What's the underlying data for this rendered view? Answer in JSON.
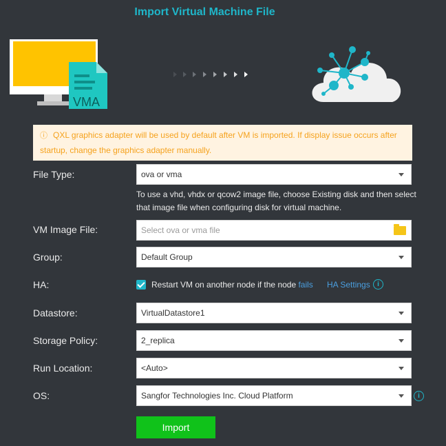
{
  "title": "Import Virtual Machine File",
  "hero": {
    "file_badge": "VMA"
  },
  "notice": {
    "icon": "warning-circle-icon",
    "text": "QXL graphics adapter will be used by default after VM is imported. If display issue occurs after startup, change the graphics adapter manually."
  },
  "form": {
    "file_type": {
      "label": "File Type:",
      "value": "ova or vma"
    },
    "hint": "To use a vhd, vhdx or qcow2 image file, choose Existing disk and then select that image file when configuring disk for virtual machine.",
    "vm_image_file": {
      "label": "VM Image File:",
      "placeholder": "Select ova or vma file"
    },
    "group": {
      "label": "Group:",
      "value": "Default Group"
    },
    "ha": {
      "label": "HA:",
      "checkbox_text": "Restart VM on another node if the node ",
      "fails_link": "fails",
      "settings_link": "HA Settings",
      "checked": true
    },
    "datastore": {
      "label": "Datastore:",
      "value": "VirtualDatastore1"
    },
    "storage_policy": {
      "label": "Storage Policy:",
      "value": "2_replica"
    },
    "run_location": {
      "label": "Run Location:",
      "value": "<Auto>"
    },
    "os": {
      "label": "OS:",
      "value": "Sangfor Technologies Inc. Cloud Platform"
    }
  },
  "import_label": "Import",
  "colors": {
    "accent": "#1fb6c9",
    "button": "#10c21a",
    "notice_bg": "#fff3e1",
    "notice_text": "#f5a21d",
    "background": "#32363b"
  }
}
